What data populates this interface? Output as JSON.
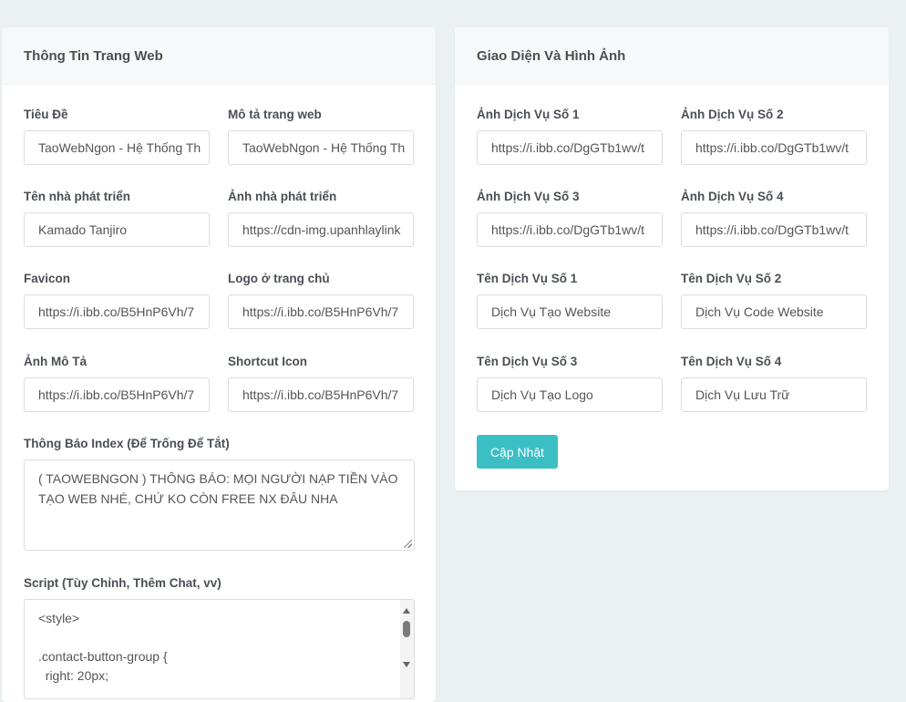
{
  "left_card": {
    "title": "Thông Tin Trang Web",
    "fields": [
      {
        "label": "Tiêu Đề",
        "value": "TaoWebNgon - Hệ Thống Th"
      },
      {
        "label": "Mô tả trang web",
        "value": "TaoWebNgon - Hệ Thống Th"
      },
      {
        "label": "Tên nhà phát triển",
        "value": "Kamado Tanjiro"
      },
      {
        "label": "Ảnh nhà phát triển",
        "value": "https://cdn-img.upanhlaylink"
      },
      {
        "label": "Favicon",
        "value": "https://i.ibb.co/B5HnP6Vh/7"
      },
      {
        "label": "Logo ở trang chủ",
        "value": "https://i.ibb.co/B5HnP6Vh/7"
      },
      {
        "label": "Ảnh Mô Tả",
        "value": "https://i.ibb.co/B5HnP6Vh/7"
      },
      {
        "label": "Shortcut Icon",
        "value": "https://i.ibb.co/B5HnP6Vh/7"
      }
    ],
    "notice": {
      "label": "Thông Báo Index (Để Trống Để Tắt)",
      "value": "( TAOWEBNGON ) THÔNG BÁO: MỌI NGƯỜI NẠP TIỀN VÀO TẠO WEB NHÉ, CHỨ KO CÒN FREE NX ĐÂU NHA"
    },
    "script": {
      "label": "Script (Tùy Chỉnh, Thêm Chat, vv)",
      "lines": [
        "<style>",
        "",
        ".contact-button-group {",
        "  right: 20px;"
      ]
    }
  },
  "right_card": {
    "title": "Giao Diện Và Hình Ảnh",
    "fields": [
      {
        "label": "Ảnh Dịch Vụ Số 1",
        "value": "https://i.ibb.co/DgGTb1wv/t"
      },
      {
        "label": "Ảnh Dịch Vụ Số 2",
        "value": "https://i.ibb.co/DgGTb1wv/t"
      },
      {
        "label": "Ảnh Dịch Vụ Số 3",
        "value": "https://i.ibb.co/DgGTb1wv/t"
      },
      {
        "label": "Ảnh Dịch Vụ Số 4",
        "value": "https://i.ibb.co/DgGTb1wv/t"
      },
      {
        "label": "Tên Dịch Vụ Số 1",
        "value": "Dịch Vụ Tạo Website"
      },
      {
        "label": "Tên Dịch Vụ Số 2",
        "value": "Dịch Vụ Code Website"
      },
      {
        "label": "Tên Dịch Vụ Số 3",
        "value": "Dịch Vụ Tạo Logo"
      },
      {
        "label": "Tên Dịch Vụ Số 4",
        "value": "Dịch Vụ Lưu Trữ"
      }
    ],
    "submit_label": "Cập Nhật"
  },
  "colors": {
    "background": "#ebf0f3",
    "accent": "#3cbfc4",
    "header_bg": "#f6f8fa"
  }
}
